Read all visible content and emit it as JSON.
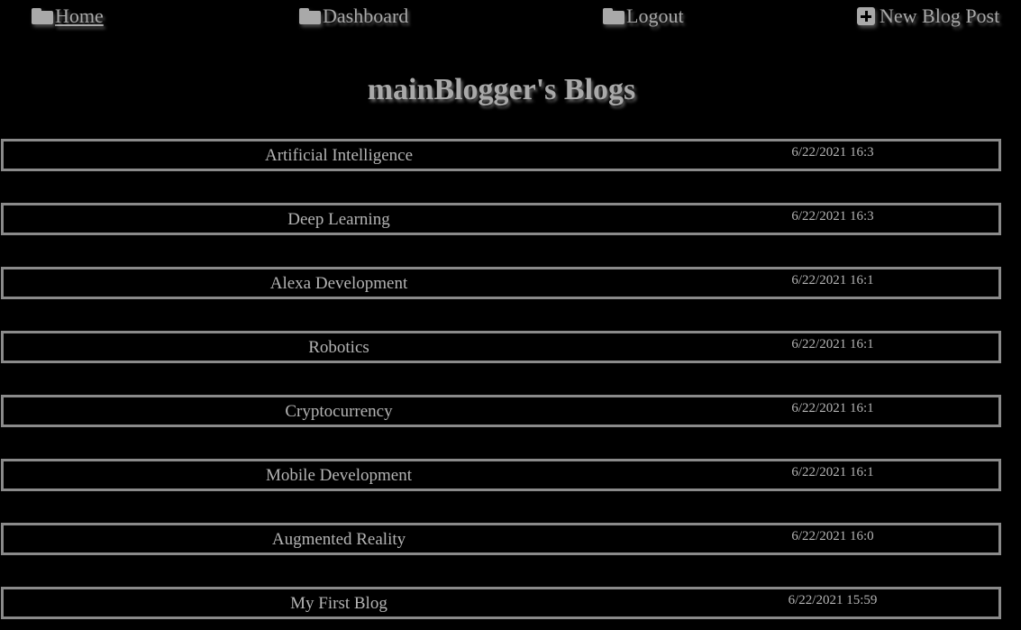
{
  "nav": {
    "items": [
      {
        "label": "Home",
        "icon": "folder-icon"
      },
      {
        "label": "Dashboard",
        "icon": "folder-icon"
      },
      {
        "label": "Logout",
        "icon": "folder-icon"
      },
      {
        "label": "New Blog Post",
        "icon": "plus-square-icon"
      }
    ]
  },
  "page": {
    "title": "mainBlogger's Blogs"
  },
  "blogs": [
    {
      "title": "Artificial Intelligence",
      "date": "6/22/2021 16:3"
    },
    {
      "title": "Deep Learning",
      "date": "6/22/2021 16:3"
    },
    {
      "title": "Alexa Development",
      "date": "6/22/2021 16:1"
    },
    {
      "title": "Robotics",
      "date": "6/22/2021 16:1"
    },
    {
      "title": "Cryptocurrency",
      "date": "6/22/2021 16:1"
    },
    {
      "title": "Mobile Development",
      "date": "6/22/2021 16:1"
    },
    {
      "title": "Augmented Reality",
      "date": "6/22/2021 16:0"
    },
    {
      "title": "My First Blog",
      "date": "6/22/2021 15:59"
    }
  ],
  "colors": {
    "background": "#000000",
    "text": "#a9a9a9",
    "border": "#8a8a8a"
  }
}
